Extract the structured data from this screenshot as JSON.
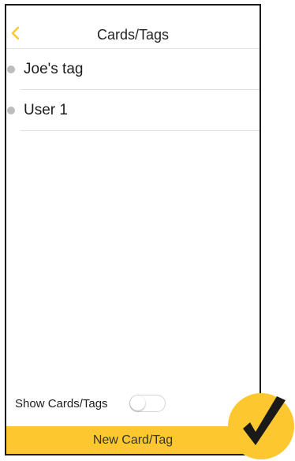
{
  "nav": {
    "title": "Cards/Tags",
    "back_icon": "chevron-left-icon"
  },
  "tags": [
    {
      "label": "Joe's tag"
    },
    {
      "label": "User 1"
    }
  ],
  "footer": {
    "show_label": "Show Cards/Tags",
    "show_toggle_on": false,
    "new_button_label": "New Card/Tag"
  },
  "overlay": {
    "icon": "checkmark-icon"
  },
  "colors": {
    "accent": "#fdc82f",
    "dot": "#bdbdbd",
    "text": "#1c1c1c"
  }
}
